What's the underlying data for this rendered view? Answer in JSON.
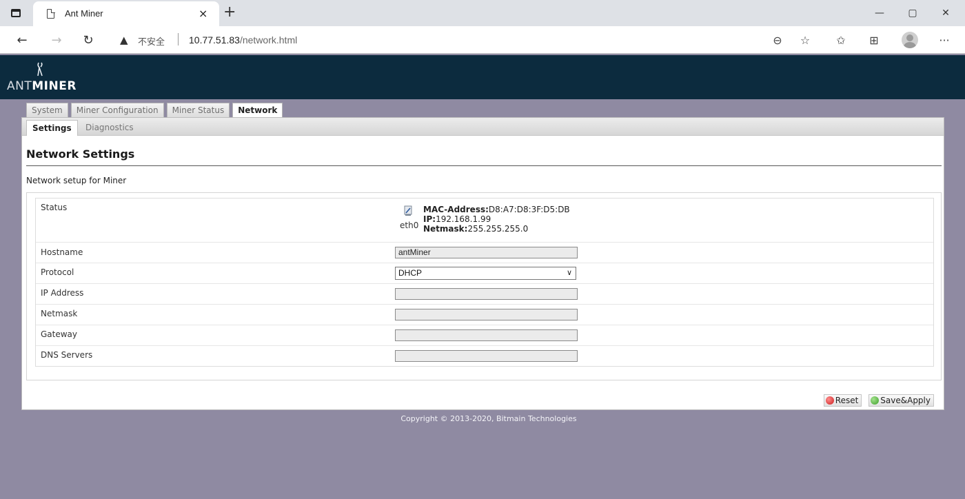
{
  "browser": {
    "tab_title": "Ant Miner",
    "tab_close": "×",
    "new_tab": "+",
    "security_label": "不安全",
    "url_host": "10.77.51.83",
    "url_path": "/network.html",
    "window_controls": [
      "—",
      "▢",
      "✕"
    ],
    "more_label": "···"
  },
  "logo": {
    "text_light": "ANT",
    "text_bold": "MINER"
  },
  "main_tabs": [
    {
      "label": "System",
      "active": false
    },
    {
      "label": "Miner Configuration",
      "active": false
    },
    {
      "label": "Miner Status",
      "active": false
    },
    {
      "label": "Network",
      "active": true
    }
  ],
  "sub_tabs": [
    {
      "label": "Settings",
      "active": true
    },
    {
      "label": "Diagnostics",
      "active": false
    }
  ],
  "page": {
    "title": "Network Settings",
    "description": "Network setup for Miner"
  },
  "status": {
    "label": "Status",
    "interface": "eth0",
    "mac_label": "MAC-Address:",
    "mac_value": "D8:A7:D8:3F:D5:DB",
    "ip_label": "IP:",
    "ip_value": "192.168.1.99",
    "netmask_label": "Netmask:",
    "netmask_value": "255.255.255.0"
  },
  "fields": {
    "hostname_label": "Hostname",
    "hostname_value": "antMiner",
    "protocol_label": "Protocol",
    "protocol_value": "DHCP",
    "ip_label": "IP Address",
    "ip_value": "",
    "netmask_label": "Netmask",
    "netmask_value": "",
    "gateway_label": "Gateway",
    "gateway_value": "",
    "dns_label": "DNS Servers",
    "dns_value": ""
  },
  "buttons": {
    "reset": "Reset",
    "save_apply": "Save&Apply"
  },
  "footer": {
    "copyright": "Copyright © 2013-2020, Bitmain Technologies"
  }
}
